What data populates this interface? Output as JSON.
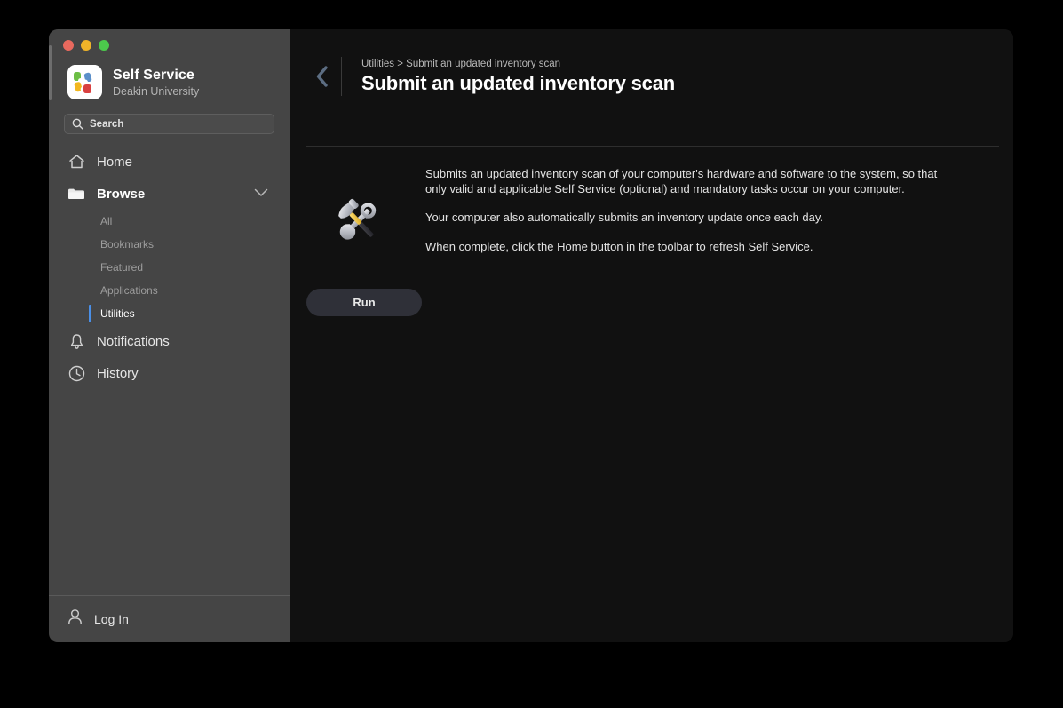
{
  "window": {
    "traffic_lights": [
      {
        "name": "close",
        "color": "#e8695e"
      },
      {
        "name": "minimize",
        "color": "#f0b429"
      },
      {
        "name": "maximize",
        "color": "#4cc94c"
      }
    ]
  },
  "sidebar": {
    "app_title": "Self Service",
    "app_subtitle": "Deakin University",
    "logo_icon": "self-service-logo",
    "search": {
      "icon": "search-icon",
      "placeholder": "Search",
      "value": ""
    },
    "nav": [
      {
        "label": "Home",
        "icon": "home-icon",
        "type": "item",
        "selected": false
      },
      {
        "label": "Browse",
        "icon": "folder-icon",
        "type": "section",
        "expanded": true,
        "chevron": "chevron-down-icon"
      },
      {
        "label": "Notifications",
        "icon": "bell-icon",
        "type": "item",
        "selected": false
      },
      {
        "label": "History",
        "icon": "clock-icon",
        "type": "item",
        "selected": false
      }
    ],
    "browse_children": [
      {
        "label": "All",
        "selected": false
      },
      {
        "label": "Bookmarks",
        "selected": false
      },
      {
        "label": "Featured",
        "selected": false
      },
      {
        "label": "Applications",
        "selected": false
      },
      {
        "label": "Utilities",
        "selected": true
      }
    ],
    "footer": {
      "label": "Log In",
      "icon": "user-icon"
    },
    "accent_color": "#4a8fe7",
    "background_color": "#454545"
  },
  "main": {
    "back_icon": "chevron-left-icon",
    "breadcrumb": "Utilities > Submit an updated inventory scan",
    "title": "Submit an updated inventory scan",
    "item_icon": "hammer-and-wrench-icon",
    "description": [
      "Submits an updated inventory scan of your computer's hardware and software to the system, so that only valid and applicable Self Service (optional) and mandatory tasks occur on your computer.",
      "Your computer also automatically submits an inventory update once each day.",
      "When complete, click the Home button in the toolbar to refresh Self Service."
    ],
    "run_button_label": "Run",
    "background_color": "#111111"
  }
}
